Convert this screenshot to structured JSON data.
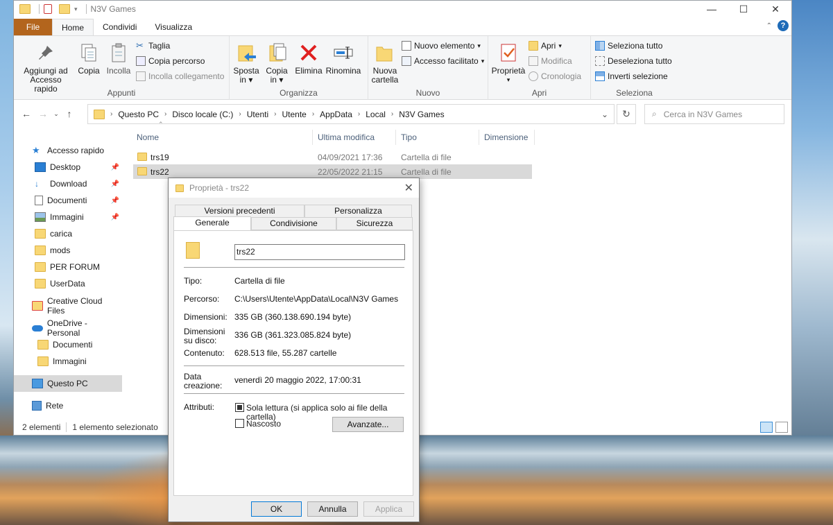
{
  "explorer": {
    "title": "N3V Games",
    "ribbon_tabs": [
      "File",
      "Home",
      "Condividi",
      "Visualizza"
    ],
    "help_icon": "?",
    "ribbon": {
      "clipboard": {
        "pin": "Aggiungi ad Accesso rapido",
        "pin_l1": "Aggiungi ad",
        "pin_l2": "Accesso rapido",
        "copy": "Copia",
        "paste": "Incolla",
        "cut": "Taglia",
        "copy_path": "Copia percorso",
        "paste_shortcut": "Incolla collegamento",
        "group": "Appunti"
      },
      "organize": {
        "move_l1": "Sposta",
        "move_l2": "in",
        "copyto_l1": "Copia",
        "copyto_l2": "in",
        "delete": "Elimina",
        "rename": "Rinomina",
        "group": "Organizza"
      },
      "new": {
        "folder_l1": "Nuova",
        "folder_l2": "cartella",
        "new_item": "Nuovo elemento",
        "easy_access": "Accesso facilitato",
        "group": "Nuovo"
      },
      "open": {
        "properties": "Proprietà",
        "open": "Apri",
        "edit": "Modifica",
        "history": "Cronologia",
        "group": "Apri"
      },
      "select": {
        "all": "Seleziona tutto",
        "none": "Deseleziona tutto",
        "invert": "Inverti selezione",
        "group": "Seleziona"
      }
    },
    "breadcrumbs": [
      "Questo PC",
      "Disco locale (C:)",
      "Utenti",
      "Utente",
      "AppData",
      "Local",
      "N3V Games"
    ],
    "search_placeholder": "Cerca in N3V Games",
    "nav": {
      "quick_access": "Accesso rapido",
      "items": [
        "Desktop",
        "Download",
        "Documenti",
        "Immagini",
        "carica",
        "mods",
        "PER FORUM",
        "UserData"
      ],
      "creative_cloud": "Creative Cloud Files",
      "onedrive": "OneDrive - Personal",
      "onedrive_items": [
        "Documenti",
        "Immagini"
      ],
      "this_pc": "Questo PC",
      "network": "Rete"
    },
    "columns": [
      "Nome",
      "Ultima modifica",
      "Tipo",
      "Dimensione"
    ],
    "files": [
      {
        "name": "trs19",
        "modified": "04/09/2021 17:36",
        "type": "Cartella di file"
      },
      {
        "name": "trs22",
        "modified": "22/05/2022 21:15",
        "type": "Cartella di file"
      }
    ],
    "status": {
      "count": "2 elementi",
      "selected": "1 elemento selezionato"
    }
  },
  "dialog": {
    "title": "Proprietà - trs22",
    "tabs_top": [
      "Versioni precedenti",
      "Personalizza"
    ],
    "tabs_bottom": [
      "Generale",
      "Condivisione",
      "Sicurezza"
    ],
    "name": "trs22",
    "labels": {
      "type": "Tipo:",
      "path": "Percorso:",
      "size": "Dimensioni:",
      "disk_l1": "Dimensioni",
      "disk_l2": "su disco:",
      "contents": "Contenuto:",
      "created_l1": "Data",
      "created_l2": "creazione:",
      "attributes": "Attributi:"
    },
    "values": {
      "type": "Cartella di file",
      "path": "C:\\Users\\Utente\\AppData\\Local\\N3V Games",
      "size": "335 GB (360.138.690.194 byte)",
      "disk": "336 GB (361.323.085.824 byte)",
      "contents": "628.513 file, 55.287 cartelle",
      "created": "venerdì 20 maggio 2022, 17:00:31"
    },
    "readonly": "Sola lettura (si applica solo ai file della cartella)",
    "hidden": "Nascosto",
    "advanced": "Avanzate...",
    "ok": "OK",
    "cancel": "Annulla",
    "apply": "Applica"
  },
  "colors": {
    "file_tab": "#b3651d",
    "accent": "#1e6bb8",
    "folder": "#f8d775",
    "selection": "#d9d9d9",
    "delete_red": "#e02020"
  }
}
